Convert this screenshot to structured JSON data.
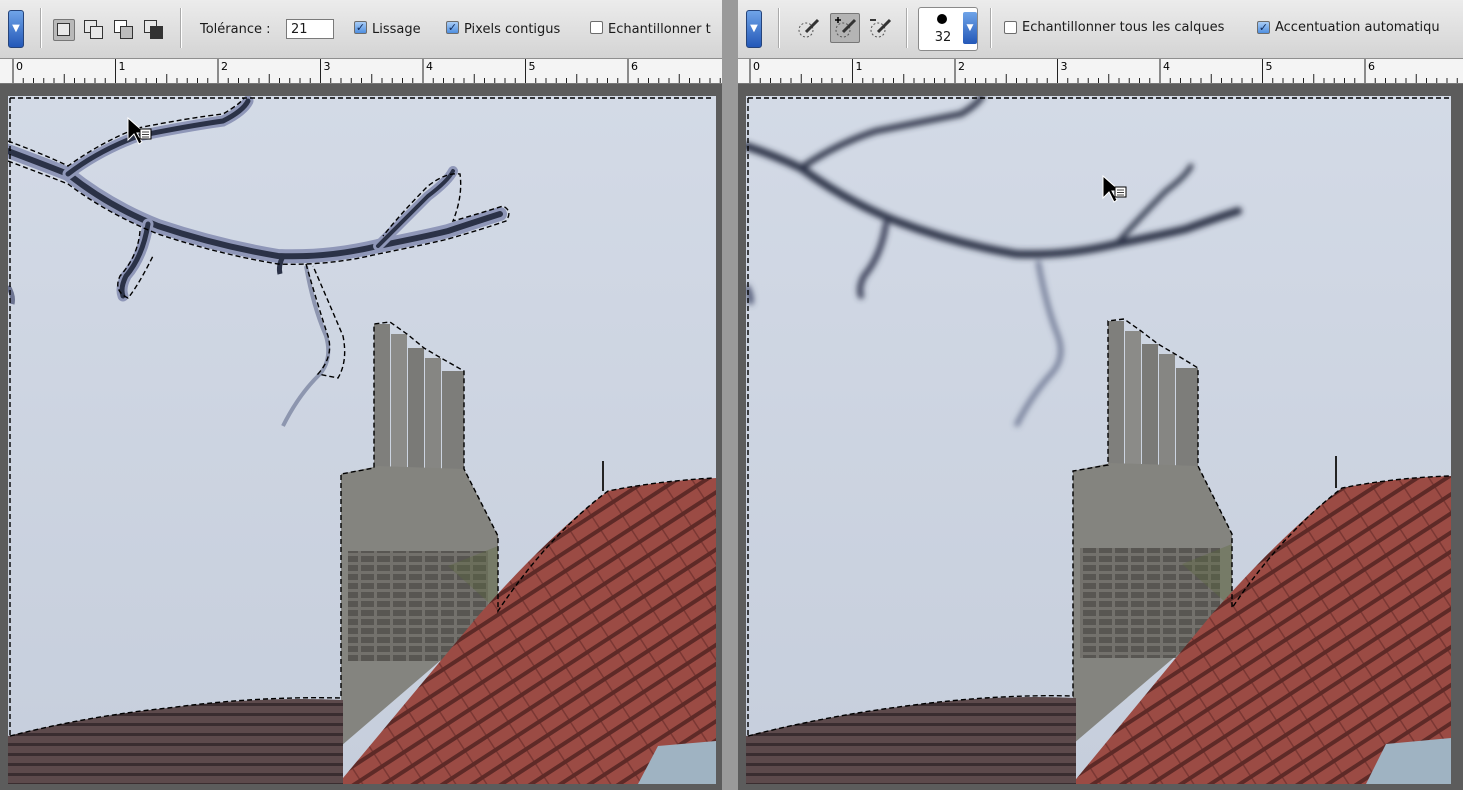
{
  "left_panel": {
    "options_bar": {
      "preset_arrow": "▼",
      "selection_modes": [
        "new-selection",
        "add-to-selection",
        "subtract-from-selection",
        "intersect-selection"
      ],
      "tolerance_label": "Tolérance :",
      "tolerance_value": "21",
      "antialias_label": "Lissage",
      "antialias_checked": true,
      "contiguous_label": "Pixels contigus",
      "contiguous_checked": true,
      "sample_all_label": "Echantillonner t",
      "sample_all_checked": false
    },
    "ruler": {
      "ticks": [
        "0",
        "1",
        "2",
        "3",
        "4",
        "5",
        "6"
      ]
    }
  },
  "right_panel": {
    "options_bar": {
      "preset_arrow": "▼",
      "brush_modes": [
        "new-selection-brush",
        "add-to-selection-brush",
        "subtract-from-selection-brush"
      ],
      "brush_size": "32",
      "sample_all_label": "Echantillonner tous les calques",
      "sample_all_checked": false,
      "auto_enhance_label": "Accentuation automatiqu",
      "auto_enhance_checked": true
    },
    "ruler": {
      "ticks": [
        "0",
        "1",
        "2",
        "3",
        "4",
        "5",
        "6"
      ]
    }
  },
  "colors": {
    "sky": "#cfd6e2",
    "roof": "#9b4b44",
    "chimney": "#8a8a86",
    "branch": "#2d3448",
    "accent": "#3f7fdc"
  }
}
